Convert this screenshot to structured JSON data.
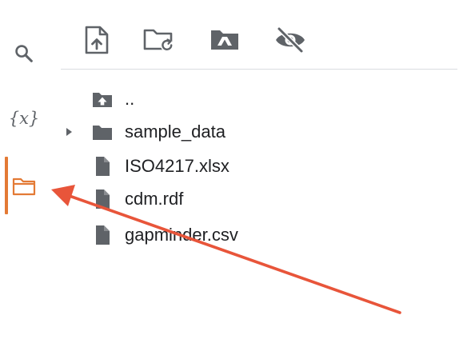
{
  "sidebar": {
    "items": [
      {
        "icon": "search-icon",
        "active": false
      },
      {
        "icon": "variables-icon",
        "label": "{x}",
        "active": false
      },
      {
        "icon": "folder-icon",
        "active": true
      }
    ],
    "active_accent_color": "#e37a35",
    "icon_color": "#5f6368"
  },
  "toolbar": {
    "buttons": [
      {
        "icon": "upload-file-icon"
      },
      {
        "icon": "refresh-folder-icon"
      },
      {
        "icon": "mount-drive-icon"
      },
      {
        "icon": "hide-hidden-files-icon"
      }
    ]
  },
  "file_tree": {
    "items": [
      {
        "name": "..",
        "kind": "parent-folder",
        "icon": "folder-up-icon"
      },
      {
        "name": "sample_data",
        "kind": "folder",
        "icon": "folder-icon",
        "expandable": true
      },
      {
        "name": "ISO4217.xlsx",
        "kind": "file",
        "icon": "file-icon"
      },
      {
        "name": "cdm.rdf",
        "kind": "file",
        "icon": "file-icon"
      },
      {
        "name": "gapminder.csv",
        "kind": "file",
        "icon": "file-icon"
      }
    ]
  },
  "annotation": {
    "arrow_color": "#e8553a",
    "points_to": "files-panel-button"
  }
}
